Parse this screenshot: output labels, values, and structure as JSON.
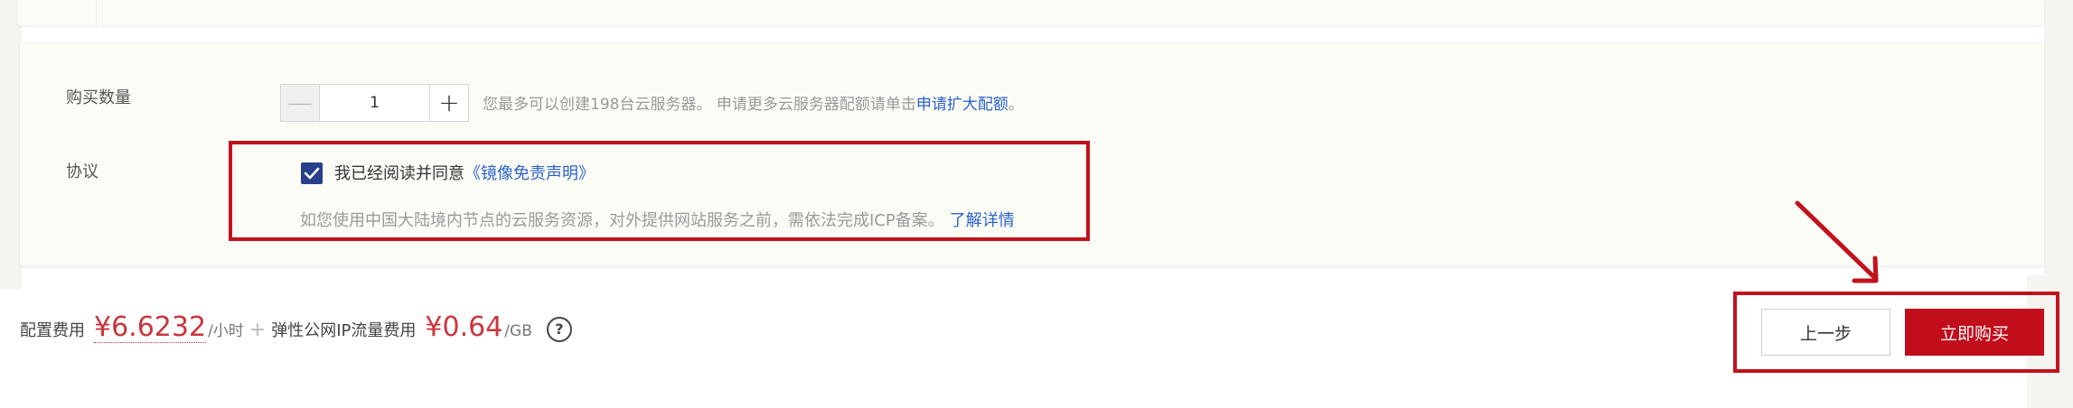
{
  "quantity": {
    "label": "购买数量",
    "minus": "—",
    "plus": "+",
    "value": "1",
    "hint_prefix": "您最多可以创建198台云服务器。 申请更多云服务器配额请单击",
    "hint_link": "申请扩大配额",
    "hint_suffix": "。"
  },
  "agreement": {
    "label": "协议",
    "checked": true,
    "text": "我已经阅读并同意",
    "link": "《镜像免责声明》",
    "icp_text": "如您使用中国大陆境内节点的云服务资源，对外提供网站服务之前，需依法完成ICP备案。",
    "icp_link": "了解详情"
  },
  "footer": {
    "config_label": "配置费用",
    "config_price": "¥6.6232",
    "config_unit": "/小时",
    "plus": "+",
    "traffic_label": "弹性公网IP流量费用",
    "traffic_price": "¥0.64",
    "traffic_unit": "/GB",
    "help": "?",
    "prev_button": "上一步",
    "buy_button": "立即购买"
  },
  "colors": {
    "accent": "#c20d1b",
    "link": "#2b63c9",
    "price": "#c9353c",
    "checkbox": "#27408b",
    "highlight_box": "#c1121c"
  },
  "icons": [
    "check-icon",
    "help-icon",
    "annotation-arrow-icon"
  ]
}
